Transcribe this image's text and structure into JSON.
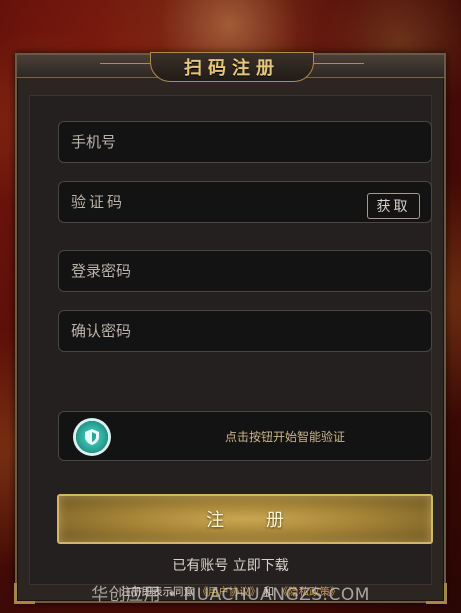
{
  "header": {
    "title": "扫码注册"
  },
  "form": {
    "phone_placeholder": "手机号",
    "code_placeholder": "验证码",
    "get_code_label": "获取",
    "password_placeholder": "登录密码",
    "confirm_password_placeholder": "确认密码",
    "verify_text": "点击按钮开始智能验证",
    "register_label": "注 册",
    "account_link": "已有账号 立即下载",
    "agreement_prefix": "注册即表示同意",
    "user_agreement": "《用户协议》",
    "and_text": "和",
    "privacy_policy": "《隐私政策》"
  },
  "watermark": "华创应用 • HUACHUANGZS.COM",
  "colors": {
    "accent_gold": "#d7b566",
    "panel": "#2b2622",
    "field": "#141313",
    "link": "#c79a4e",
    "verify_icon": "#2aa79a"
  }
}
